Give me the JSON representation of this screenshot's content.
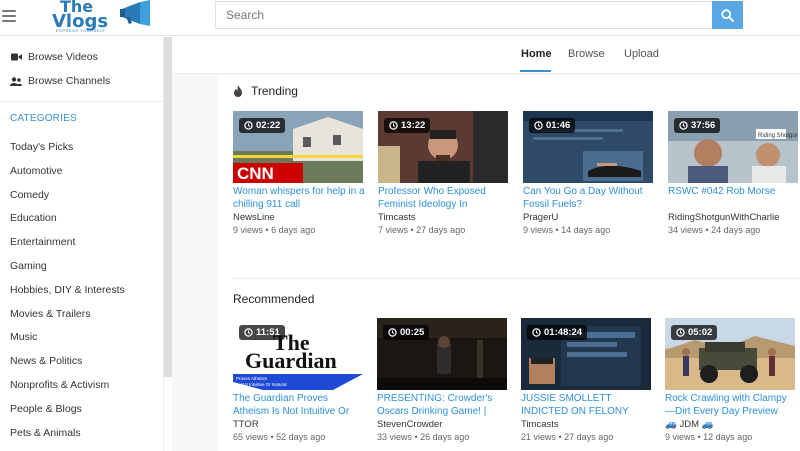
{
  "header": {
    "logo_line1": "The",
    "logo_line2": "Vlogs",
    "logo_tagline": "EXPRESS YOURSELF",
    "search_placeholder": "Search"
  },
  "sidebar": {
    "browse_videos": "Browse Videos",
    "browse_channels": "Browse Channels",
    "categories_heading": "CATEGORIES",
    "categories": [
      "Today's Picks",
      "Automotive",
      "Comedy",
      "Education",
      "Entertainment",
      "Gaming",
      "Hobbies, DIY & Interests",
      "Movies & Trailers",
      "Music",
      "News & Politics",
      "Nonprofits & Activism",
      "People & Blogs",
      "Pets & Animals"
    ]
  },
  "nav": {
    "tabs": [
      "Home",
      "Browse",
      "Upload"
    ]
  },
  "trending": {
    "title": "Trending",
    "videos": [
      {
        "duration": "02:22",
        "title": "Woman whispers for help in a chilling 911 call",
        "channel": "NewsLine",
        "meta": "9 views • 6 days ago"
      },
      {
        "duration": "13:22",
        "title": "Professor Who Exposed Feminist Ideology In",
        "channel": "Timcasts",
        "meta": "7 views • 27 days ago"
      },
      {
        "duration": "01:46",
        "title": "Can You Go a Day Without Fossil Fuels?",
        "channel": "PragerU",
        "meta": "9 views • 14 days ago"
      },
      {
        "duration": "37:56",
        "title": "RSWC #042 Rob Morse",
        "channel": "RidingShotgunWithCharlie",
        "meta": "34 views • 24 days ago"
      }
    ]
  },
  "recommended": {
    "title": "Recommended",
    "videos": [
      {
        "duration": "11:51",
        "title": "The Guardian Proves Atheism Is Not Intuitive Or",
        "channel": "TTOR",
        "meta": "65 views • 52 days ago",
        "thumb_text1": "The",
        "thumb_text2": "Guardian",
        "thumb_caption": "Proves Atheism Is Not Intuitive Or Natural"
      },
      {
        "duration": "00:25",
        "title": "PRESENTING: Crowder's Oscars Drinking Game! |",
        "channel": "StevenCrowder",
        "meta": "33 views • 26 days ago"
      },
      {
        "duration": "01:48:24",
        "title": "JUSSIE SMOLLETT INDICTED ON FELONY",
        "channel": "Timcasts",
        "meta": "21 views • 27 days ago"
      },
      {
        "duration": "05:02",
        "title": "Rock Crawling with Clampy —Dirt Every Day Preview",
        "channel": "JDM",
        "meta": "9 views • 12 days ago"
      }
    ]
  },
  "colors": {
    "accent": "#3a8fd1",
    "link": "#2d8fd9",
    "search_button": "#5aa7e6"
  }
}
